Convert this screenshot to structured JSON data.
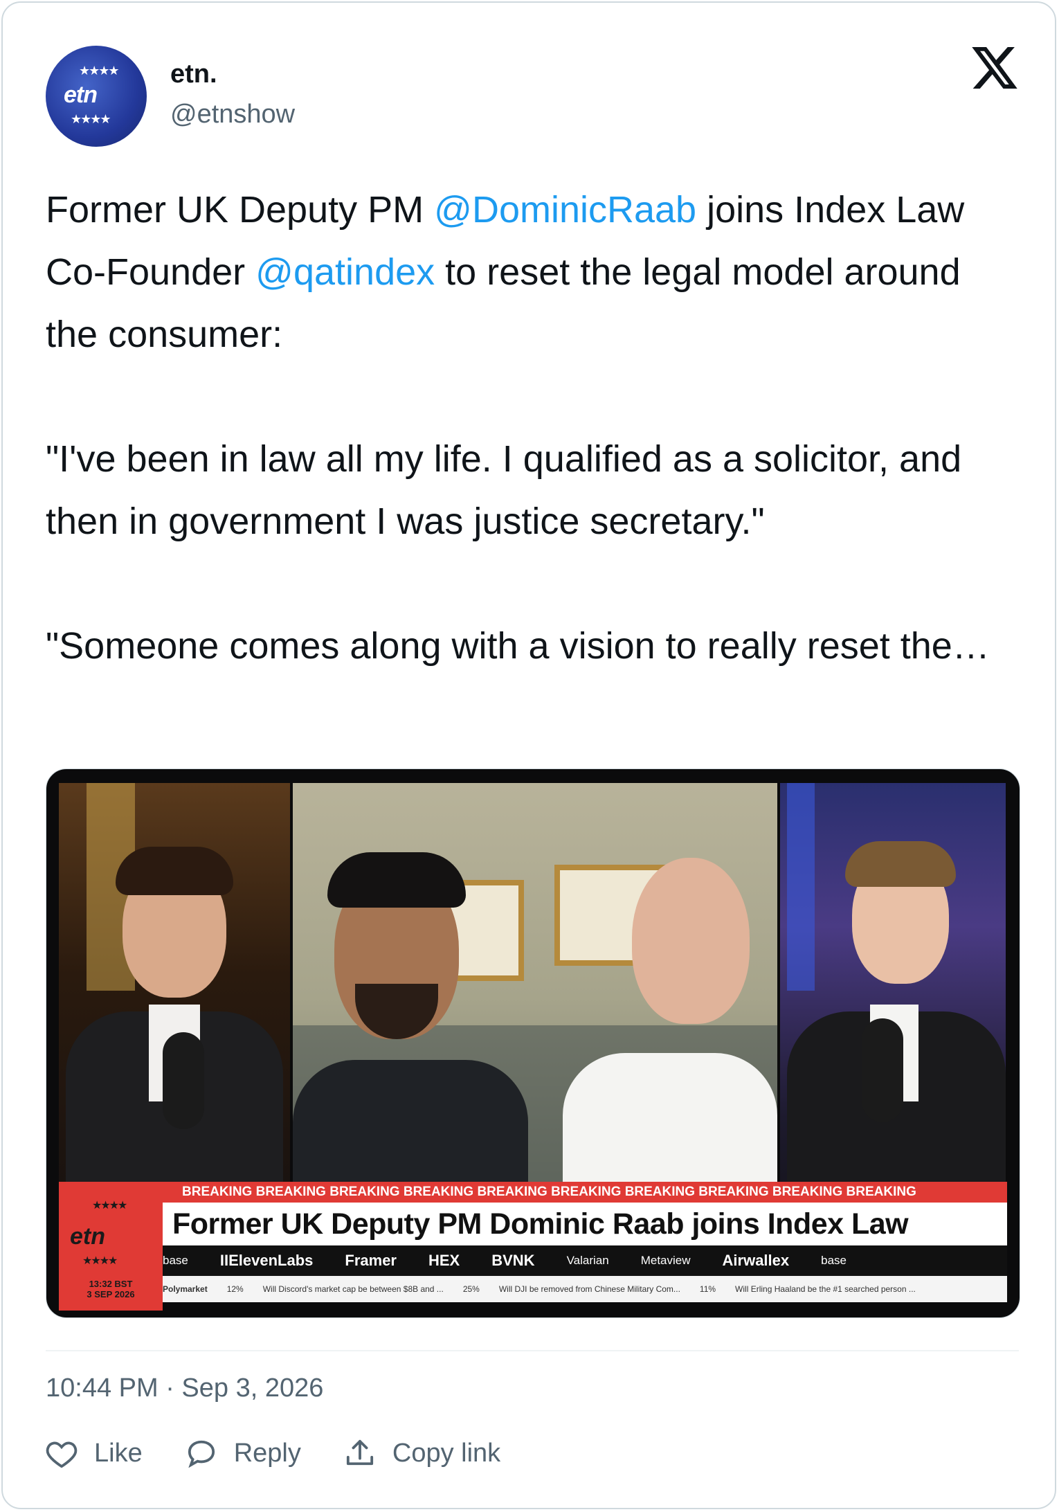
{
  "user": {
    "display_name": "etn.",
    "handle": "@etnshow",
    "avatar_text": "etn"
  },
  "tweet": {
    "text_segments": [
      {
        "t": "Former UK Deputy PM ",
        "type": "text"
      },
      {
        "t": "@DominicRaab",
        "type": "mention"
      },
      {
        "t": " joins Index Law Co-Founder ",
        "type": "text"
      },
      {
        "t": "@qatindex",
        "type": "mention"
      },
      {
        "t": " to reset the legal model around the consumer:\n\n\"I've been in law all my life. I qualified as a solicitor, and then in government I was justice secretary.\"\n\n\"Someone comes along with a vision to really reset the…",
        "type": "text"
      }
    ],
    "timestamp": "10:44 PM · Sep 3, 2026"
  },
  "media": {
    "lower_third": {
      "logo": "etn",
      "time": "13:32 BST",
      "date": "3 SEP 2026",
      "breaking": "BREAKING  BREAKING  BREAKING  BREAKING  BREAKING  BREAKING  BREAKING  BREAKING  BREAKING  BREAKING",
      "headline": "Former UK Deputy PM Dominic Raab joins Index Law",
      "sponsors": [
        "base",
        "IIElevenLabs",
        "Framer",
        "HEX",
        "BVNK",
        "Valarian",
        "Metaview",
        "Airwallex",
        "base"
      ],
      "markets": [
        "Polymarket",
        "12%",
        "Will Discord's market cap be between $8B and ...",
        "25%",
        "Will DJI be removed from Chinese Military Com...",
        "11%",
        "Will Erling Haaland be the #1 searched person ..."
      ]
    }
  },
  "actions": {
    "like": "Like",
    "reply": "Reply",
    "copy_link": "Copy link"
  },
  "colors": {
    "mention": "#1d9bf0",
    "secondary_text": "#536471",
    "breaking_red": "#e03a35"
  },
  "icons": [
    "x-logo-icon",
    "heart-icon",
    "reply-bubble-icon",
    "share-upload-icon"
  ]
}
